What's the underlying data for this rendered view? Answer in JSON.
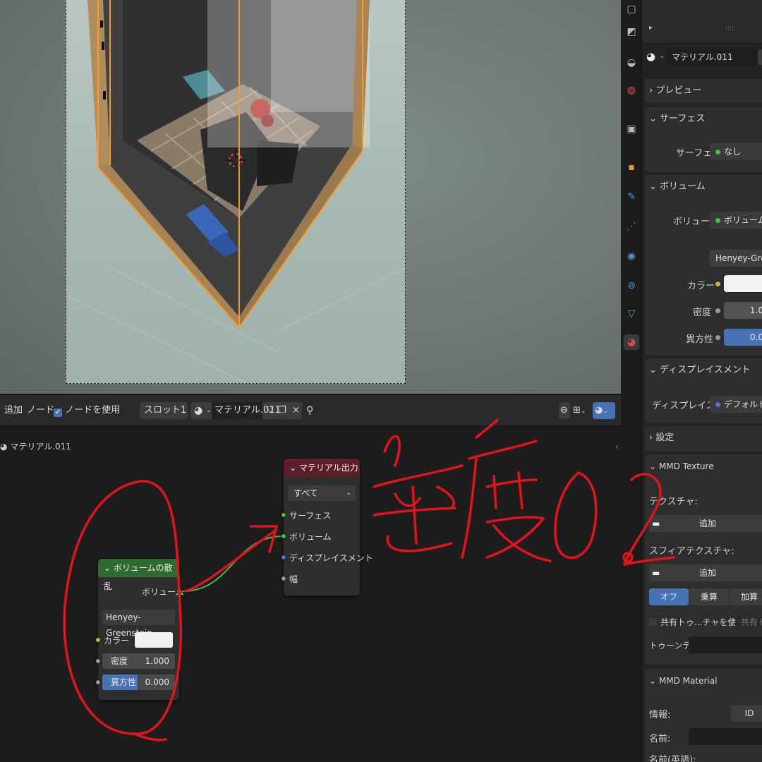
{
  "viewport": {
    "label": ""
  },
  "properties": {
    "material_name": "マテリアル.011",
    "top_icons": {
      "play": "▸",
      "dots": "::::"
    },
    "preview": {
      "label": "プレビュー"
    },
    "surface": {
      "header": "サーフェス",
      "label": "サーフェス",
      "value": "なし"
    },
    "volume": {
      "header": "ボリューム",
      "label": "ボリューム",
      "value": "ボリュームの",
      "phase": "Henyey-Green",
      "color_label": "カラー",
      "density_label": "密度",
      "density_value": "1.0",
      "aniso_label": "異方性",
      "aniso_value": "0.0"
    },
    "displacement": {
      "header": "ディスプレイスメント",
      "label": "ディスプレイス...",
      "value": "デフォルト"
    },
    "settings": {
      "header": "設定"
    },
    "mmd_texture": {
      "header": "MMD Texture",
      "texture_label": "テクスチャ:",
      "add1": "追加",
      "sphere_label": "スフィアテクスチャ:",
      "add2": "追加",
      "mode_off": "オフ",
      "mode_mul": "乗算",
      "mode_add": "加算",
      "shared_toon": "共有トゥ...チャを使用",
      "shared_toon_field": "共有ト",
      "toon_label": "トゥーンテ..."
    },
    "mmd_material": {
      "header": "MMD Material",
      "info_label": "情報:",
      "info_value": "ID",
      "name_label": "名前:",
      "name_en_label": "名前(英語):"
    }
  },
  "node_editor": {
    "menu": {
      "add": "追加",
      "node": "ノード",
      "use_nodes": "ノードを使用"
    },
    "slot": "スロット1",
    "material": "マテリアル.011",
    "breadcrumb": "マテリアル.011",
    "output_node": {
      "title": "マテリアル出力",
      "target": "すべて",
      "surface": "サーフェス",
      "volume": "ボリューム",
      "displacement": "ディスプレイスメント",
      "thickness": "幅"
    },
    "scatter_node": {
      "title": "ボリュームの散乱",
      "out_volume": "ボリューム",
      "phase": "Henyey-Greenstein",
      "color": "カラー",
      "density_label": "密度",
      "density_value": "1.000",
      "aniso_label": "異方性",
      "aniso_value": "0.000"
    }
  },
  "annotation": {
    "text": "密度0.2",
    "color": "#e0141c"
  },
  "colors": {
    "volume_header": "#2f6a2e",
    "output_header": "#5c1f2a",
    "socket_green": "#39c34a",
    "socket_yellow": "#c7b33a",
    "socket_grey": "#9a9a9a",
    "socket_blue": "#5a6fcf",
    "accent_blue": "#4772b3",
    "selection_orange": "#f29c2a"
  }
}
